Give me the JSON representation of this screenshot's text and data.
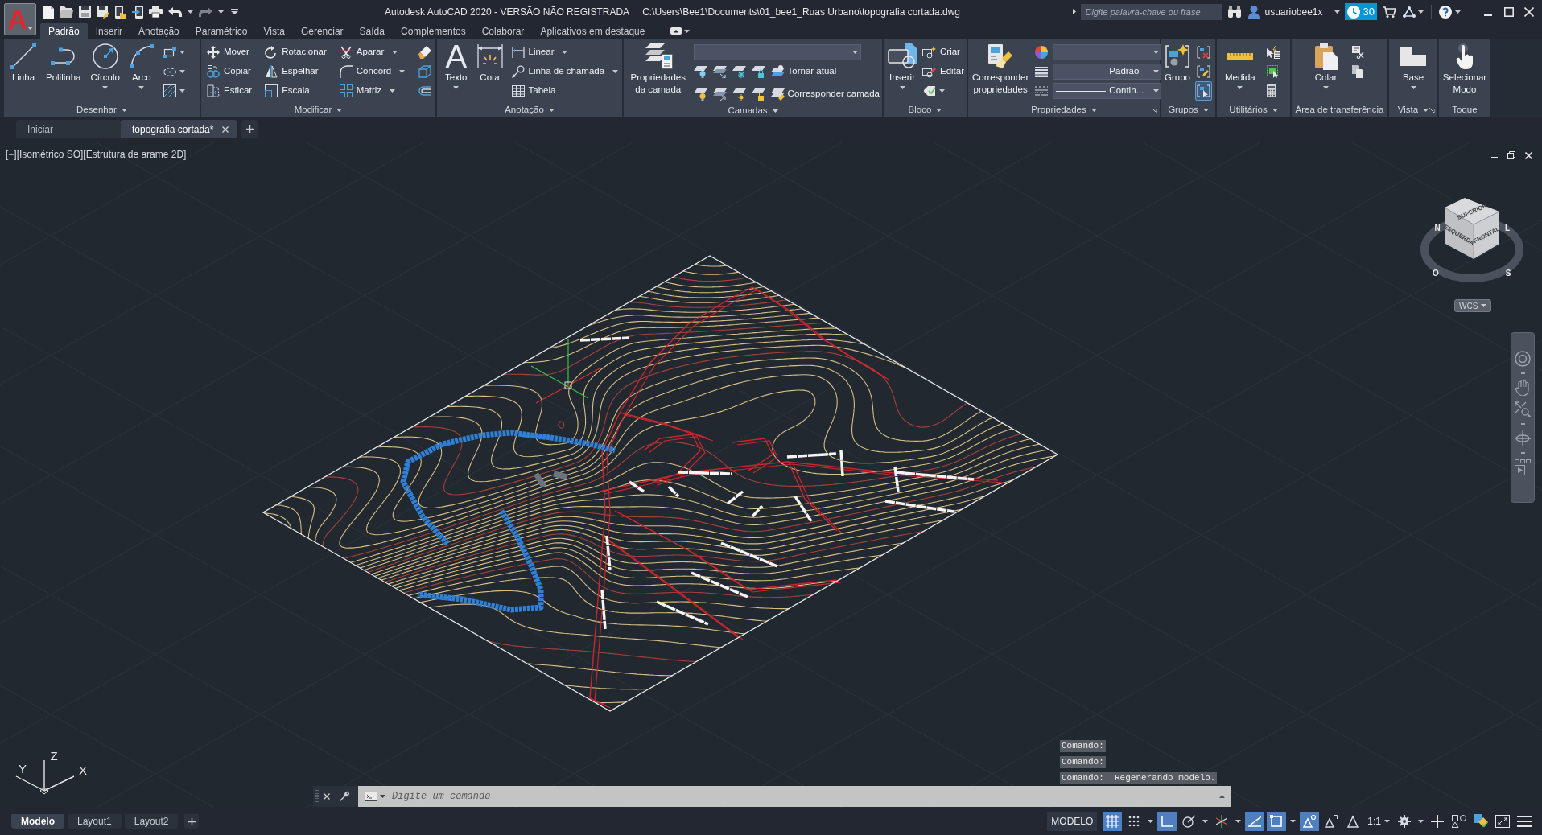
{
  "app_button": {
    "glyph": "A"
  },
  "window": {
    "title": "Autodesk AutoCAD 2020 - VERSÃO NÃO REGISTRADA",
    "path": "C:\\Users\\Bee1\\Documents\\01_bee1_Ruas Urbano\\topografia cortada.dwg"
  },
  "search": {
    "placeholder": "Digite palavra-chave ou frase"
  },
  "account": {
    "user": "usuariobee1x",
    "trial_days": "30"
  },
  "ribbon_tabs": [
    {
      "label": "Padrão",
      "selected": true
    },
    {
      "label": "Inserir",
      "selected": false
    },
    {
      "label": "Anotação",
      "selected": false
    },
    {
      "label": "Paramétrico",
      "selected": false
    },
    {
      "label": "Vista",
      "selected": false
    },
    {
      "label": "Gerenciar",
      "selected": false
    },
    {
      "label": "Saída",
      "selected": false
    },
    {
      "label": "Complementos",
      "selected": false
    },
    {
      "label": "Colaborar",
      "selected": false
    },
    {
      "label": "Aplicativos em destaque",
      "selected": false
    }
  ],
  "ribbon_panels": [
    {
      "title": "Desenhar",
      "menu": true,
      "launcher": false,
      "columns": [
        [
          {
            "kind": "large",
            "label": "Linha",
            "menu": false
          }
        ],
        [
          {
            "kind": "large",
            "label": "Polilinha",
            "menu": false
          }
        ],
        [
          {
            "kind": "large",
            "label": "Círculo",
            "menu": true
          }
        ],
        [
          {
            "kind": "large",
            "label": "Arco",
            "menu": true
          }
        ],
        [
          {
            "kind": "icon",
            "menu": true
          },
          {
            "kind": "icon",
            "menu": true
          },
          {
            "kind": "icon",
            "menu": true
          }
        ]
      ]
    },
    {
      "title": "Modificar",
      "menu": true,
      "launcher": false,
      "columns": [
        [
          {
            "kind": "small",
            "label": "Mover",
            "menu": false
          },
          {
            "kind": "small",
            "label": "Copiar",
            "menu": false
          },
          {
            "kind": "small",
            "label": "Esticar",
            "menu": false
          }
        ],
        [
          {
            "kind": "small",
            "label": "Rotacionar",
            "menu": false
          },
          {
            "kind": "small",
            "label": "Espelhar",
            "menu": false
          },
          {
            "kind": "small",
            "label": "Escala",
            "menu": false
          }
        ],
        [
          {
            "kind": "small",
            "label": "Aparar",
            "menu": true
          },
          {
            "kind": "small",
            "label": "Concord",
            "menu": true
          },
          {
            "kind": "small",
            "label": "Matriz",
            "menu": true
          }
        ],
        [
          {
            "kind": "icon",
            "menu": false
          },
          {
            "kind": "icon",
            "menu": false
          },
          {
            "kind": "icon",
            "menu": false
          }
        ]
      ]
    },
    {
      "title": "Anotação",
      "menu": true,
      "launcher": false,
      "columns": [
        [
          {
            "kind": "large",
            "label": "Texto",
            "glyph": "A",
            "menu": true
          }
        ],
        [
          {
            "kind": "large",
            "label": "Cota",
            "menu": false
          }
        ],
        [
          {
            "kind": "small",
            "label": "Linear",
            "menu": true
          },
          {
            "kind": "small",
            "label": "Linha de chamada",
            "menu": true
          },
          {
            "kind": "small",
            "label": "Tabela",
            "menu": false
          }
        ]
      ]
    },
    {
      "title": "Camadas",
      "menu": true,
      "launcher": false,
      "columns": [
        [
          {
            "kind": "large",
            "label": "Propriedades da camada",
            "menu": false
          }
        ],
        [
          {
            "kind": "combo",
            "line": false
          },
          {
            "kind": "icon_row",
            "label": "Tornar atual"
          },
          {
            "kind": "icon_row",
            "label": "Corresponder camada"
          }
        ]
      ]
    },
    {
      "title": "Bloco",
      "menu": true,
      "launcher": false,
      "columns": [
        [
          {
            "kind": "large",
            "label": "Inserir",
            "menu": true
          }
        ],
        [
          {
            "kind": "small",
            "label": "Criar",
            "menu": false
          },
          {
            "kind": "small",
            "label": "Editar",
            "menu": false
          },
          {
            "kind": "icon",
            "menu": true
          }
        ]
      ]
    },
    {
      "title": "Propriedades",
      "menu": true,
      "launcher": true,
      "columns": [
        [
          {
            "kind": "large",
            "label": "Corresponder propriedades",
            "menu": false
          }
        ],
        [
          {
            "kind": "icon",
            "menu": false
          },
          {
            "kind": "icon",
            "menu": false
          },
          {
            "kind": "icon",
            "menu": false
          }
        ],
        [
          {
            "kind": "combo",
            "line": false
          },
          {
            "kind": "combo",
            "line": true,
            "value": "Padrão"
          },
          {
            "kind": "combo",
            "line": true,
            "value": "Contin..."
          }
        ]
      ]
    },
    {
      "title": "Grupos",
      "menu": true,
      "launcher": false,
      "columns": [
        [
          {
            "kind": "large",
            "label": "Grupo",
            "menu": false
          }
        ],
        [
          {
            "kind": "icon",
            "menu": false,
            "active": false
          },
          {
            "kind": "icon",
            "menu": false,
            "active": false
          },
          {
            "kind": "icon",
            "menu": false,
            "active": true
          }
        ]
      ]
    },
    {
      "title": "Utilitários",
      "menu": true,
      "launcher": false,
      "columns": [
        [
          {
            "kind": "large",
            "label": "Medida",
            "menu": true
          }
        ],
        [
          {
            "kind": "icon",
            "menu": false
          },
          {
            "kind": "icon",
            "menu": false
          },
          {
            "kind": "icon",
            "menu": false
          }
        ]
      ]
    },
    {
      "title": "Área de transferência",
      "menu": false,
      "launcher": false,
      "columns": [
        [
          {
            "kind": "large",
            "label": "Colar",
            "menu": true
          }
        ],
        [
          {
            "kind": "icon",
            "menu": false
          },
          {
            "kind": "icon",
            "menu": false
          }
        ]
      ]
    },
    {
      "title": "Vista",
      "menu": true,
      "launcher": true,
      "columns": [
        [
          {
            "kind": "large",
            "label": "Base",
            "menu": true
          }
        ]
      ]
    },
    {
      "title": "Toque",
      "menu": false,
      "launcher": false,
      "columns": [
        [
          {
            "kind": "large",
            "label": "Selecionar Modo",
            "menu": false
          }
        ]
      ]
    }
  ],
  "document_tabs": [
    {
      "label": "Iniciar",
      "selected": false
    },
    {
      "label": "topografia cortada*",
      "selected": true
    }
  ],
  "viewport": {
    "label": "[−][Isométrico SO][Estrutura de arame 2D]",
    "viewcube": {
      "top": "SUPERIOR",
      "left": "ESQUERDA",
      "front": "FRONTAL",
      "north": "N",
      "east": "L",
      "south": "S",
      "west": "O"
    },
    "ucs_menu": "WCS",
    "ucs_axes": {
      "x": "X",
      "y": "Y",
      "z": "Z"
    }
  },
  "command_line": {
    "history": [
      "Comando:",
      "Comando:",
      "Comando:  Regenerando modelo."
    ],
    "placeholder": "Digite um comando"
  },
  "layout_tabs": [
    {
      "label": "Modelo",
      "selected": true
    },
    {
      "label": "Layout1",
      "selected": false
    },
    {
      "label": "Layout2",
      "selected": false
    }
  ],
  "status_bar": {
    "space": "MODELO",
    "tools": [
      {
        "kind": "toggle",
        "on": true,
        "menu": false
      },
      {
        "kind": "toggle",
        "on": false,
        "menu": true
      },
      {
        "kind": "toggle",
        "on": true,
        "menu": false
      },
      {
        "kind": "toggle",
        "on": false,
        "menu": true
      },
      {
        "kind": "toggle",
        "on": false,
        "menu": true
      },
      {
        "kind": "toggle",
        "on": true,
        "menu": false
      },
      {
        "kind": "toggle",
        "on": true,
        "menu": true
      },
      {
        "kind": "toggle",
        "on": true,
        "menu": false
      },
      {
        "kind": "toggle",
        "on": false,
        "menu": false
      },
      {
        "kind": "toggle",
        "on": false,
        "menu": false
      },
      {
        "kind": "scale",
        "label": "1:1",
        "menu": true
      },
      {
        "kind": "toggle",
        "on": false,
        "menu": true
      },
      {
        "kind": "toggle",
        "on": false,
        "menu": false
      },
      {
        "kind": "toggle",
        "on": false,
        "menu": false
      },
      {
        "kind": "toggle",
        "on": false,
        "menu": false
      },
      {
        "kind": "toggle",
        "on": false,
        "menu": false
      },
      {
        "kind": "toggle",
        "on": false,
        "menu": false
      }
    ]
  }
}
